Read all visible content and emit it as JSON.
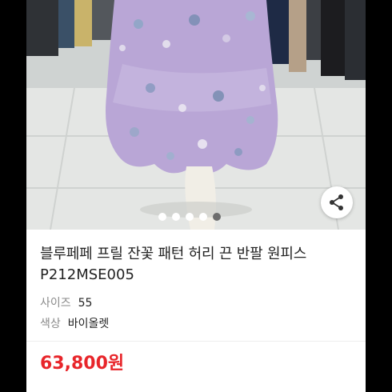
{
  "product": {
    "title": "블루페페 프릴 잔꽃 패턴 허리 끈 반팔 원피스",
    "code": "P212MSE005",
    "options": [
      {
        "label": "사이즈",
        "value": "55"
      },
      {
        "label": "색상",
        "value": "바이올렛"
      }
    ],
    "price": "63,800원"
  },
  "gallery": {
    "image_count": 5,
    "active_index": 4,
    "subject": "lavender floral chiffon dress on mannequin"
  },
  "icons": {
    "share": "share-icon"
  },
  "colors": {
    "price": "#e8252a",
    "dress": "#b9a6d6",
    "label": "#8a8a8a",
    "text": "#222222"
  }
}
